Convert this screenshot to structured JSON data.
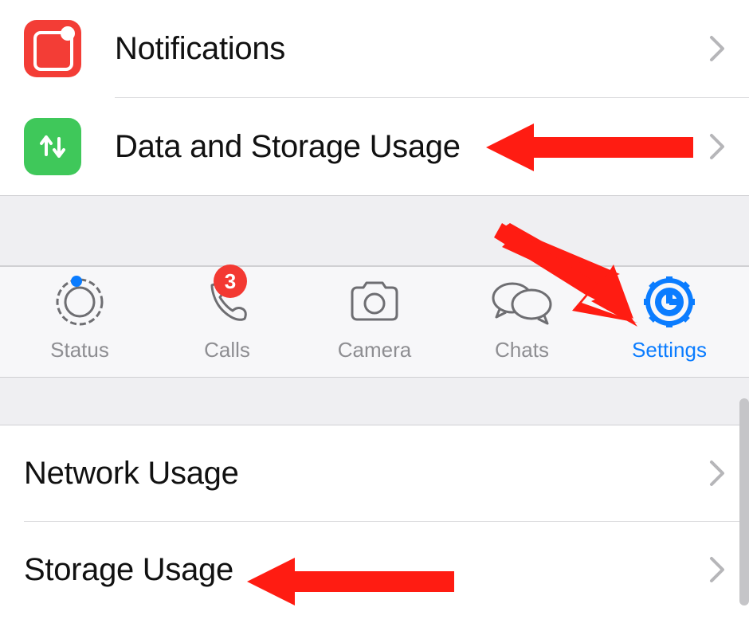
{
  "settings_rows": [
    {
      "label": "Notifications",
      "icon": "notifications"
    },
    {
      "label": "Data and Storage Usage",
      "icon": "data"
    }
  ],
  "tabs": {
    "status": {
      "label": "Status"
    },
    "calls": {
      "label": "Calls",
      "badge": "3"
    },
    "camera": {
      "label": "Camera"
    },
    "chats": {
      "label": "Chats"
    },
    "settings": {
      "label": "Settings",
      "active": true
    }
  },
  "lower_rows": [
    {
      "label": "Network Usage"
    },
    {
      "label": "Storage Usage"
    }
  ],
  "colors": {
    "accent": "#0a7cff",
    "badge": "#f33932",
    "green": "#3fc85a",
    "red_icon": "#f33d36",
    "arrow": "#ff1c12"
  }
}
